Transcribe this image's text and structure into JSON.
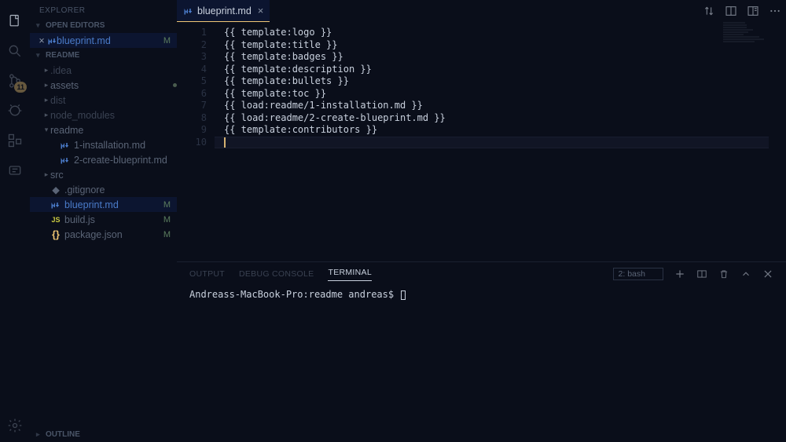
{
  "explorer": {
    "title": "EXPLORER",
    "open_editors_label": "OPEN EDITORS",
    "open_editors": [
      {
        "name": "blueprint.md",
        "status": "M"
      }
    ],
    "project_label": "README",
    "tree": [
      {
        "depth": 0,
        "chev": "▸",
        "name": ".idea",
        "dim": true
      },
      {
        "depth": 0,
        "chev": "▸",
        "name": "assets",
        "dot": true
      },
      {
        "depth": 0,
        "chev": "▸",
        "name": "dist",
        "dim": true
      },
      {
        "depth": 0,
        "chev": "▸",
        "name": "node_modules",
        "dim": true
      },
      {
        "depth": 0,
        "chev": "▾",
        "name": "readme"
      },
      {
        "depth": 1,
        "icon": "md",
        "name": "1-installation.md"
      },
      {
        "depth": 1,
        "icon": "md",
        "name": "2-create-blueprint.md"
      },
      {
        "depth": 0,
        "chev": "▸",
        "name": "src"
      },
      {
        "depth": 0,
        "icon": "git",
        "name": ".gitignore"
      },
      {
        "depth": 0,
        "icon": "md",
        "name": "blueprint.md",
        "sel": true,
        "status": "M"
      },
      {
        "depth": 0,
        "icon": "js",
        "name": "build.js",
        "status": "M"
      },
      {
        "depth": 0,
        "icon": "json",
        "name": "package.json",
        "status": "M"
      }
    ],
    "outline_label": "OUTLINE"
  },
  "scm_badge": "11",
  "tab": {
    "label": "blueprint.md"
  },
  "code_lines": [
    "{{ template:logo }}",
    "{{ template:title }}",
    "{{ template:badges }}",
    "{{ template:description }}",
    "{{ template:bullets }}",
    "{{ template:toc }}",
    "{{ load:readme/1-installation.md }}",
    "{{ load:readme/2-create-blueprint.md }}",
    "{{ template:contributors }}"
  ],
  "line_numbers": [
    "1",
    "2",
    "3",
    "4",
    "5",
    "6",
    "7",
    "8",
    "9",
    "10"
  ],
  "panel": {
    "tabs": {
      "output": "OUTPUT",
      "debug": "DEBUG CONSOLE",
      "terminal": "TERMINAL"
    },
    "terminal_selector": "2: bash",
    "prompt": "Andreass-MacBook-Pro:readme andreas$ "
  }
}
